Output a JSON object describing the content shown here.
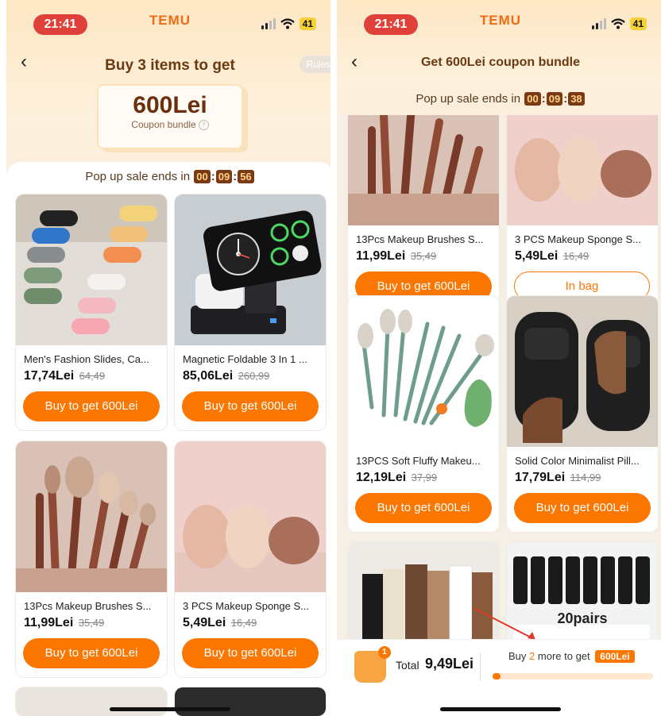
{
  "left": {
    "status": {
      "time": "21:41",
      "brand": "TEMU",
      "battery": "41"
    },
    "header": {
      "title": "Buy 3 items to get",
      "rules": "Rules"
    },
    "coupon": {
      "amount": "600Lei",
      "label": "Coupon bundle"
    },
    "timer": {
      "label": "Pop up sale ends in",
      "hh": "00",
      "mm": "09",
      "ss": "56"
    },
    "products": [
      {
        "name": "Men's Fashion Slides, Ca...",
        "price": "17,74Lei",
        "old": "64,49",
        "button": "Buy to get 600Lei",
        "image": "slides-photo"
      },
      {
        "name": "Magnetic Foldable 3 In 1 ...",
        "price": "85,06Lei",
        "old": "260,99",
        "button": "Buy to get 600Lei",
        "image": "charger-photo"
      },
      {
        "name": "13Pcs Makeup Brushes S...",
        "price": "11,99Lei",
        "old": "35,49",
        "button": "Buy to get 600Lei",
        "image": "brushes-photo"
      },
      {
        "name": "3 PCS Makeup Sponge S...",
        "price": "5,49Lei",
        "old": "16,49",
        "button": "Buy to get 600Lei",
        "image": "sponges-photo"
      }
    ]
  },
  "right": {
    "status": {
      "time": "21:41",
      "brand": "TEMU",
      "battery": "41"
    },
    "header": {
      "title": "Get 600Lei coupon bundle"
    },
    "timer": {
      "label": "Pop up sale ends in",
      "hh": "00",
      "mm": "09",
      "ss": "38"
    },
    "products": [
      {
        "name": "13Pcs Makeup Brushes S...",
        "price": "11,99Lei",
        "old": "35,49",
        "button": "Buy to get 600Lei",
        "image": "brushes-photo"
      },
      {
        "name": "3 PCS Makeup Sponge S...",
        "price": "5,49Lei",
        "old": "16,49",
        "button": "In bag",
        "image": "sponges-photo"
      },
      {
        "name": "13PCS Soft Fluffy Makeu...",
        "price": "12,19Lei",
        "old": "37,99",
        "button": "Buy to get 600Lei",
        "image": "green-brushes-photo"
      },
      {
        "name": "Solid Color Minimalist Pill...",
        "price": "17,79Lei",
        "old": "114,99",
        "button": "Buy to get 600Lei",
        "image": "black-slides-photo"
      }
    ],
    "socks_label": "20pairs",
    "bottom": {
      "bag_count": "1",
      "total_label": "Total",
      "total": "9,49Lei",
      "more_prefix": "Buy",
      "more_count": "2",
      "more_suffix": "more to get",
      "target": "600Lei",
      "progress": 0.05
    }
  }
}
